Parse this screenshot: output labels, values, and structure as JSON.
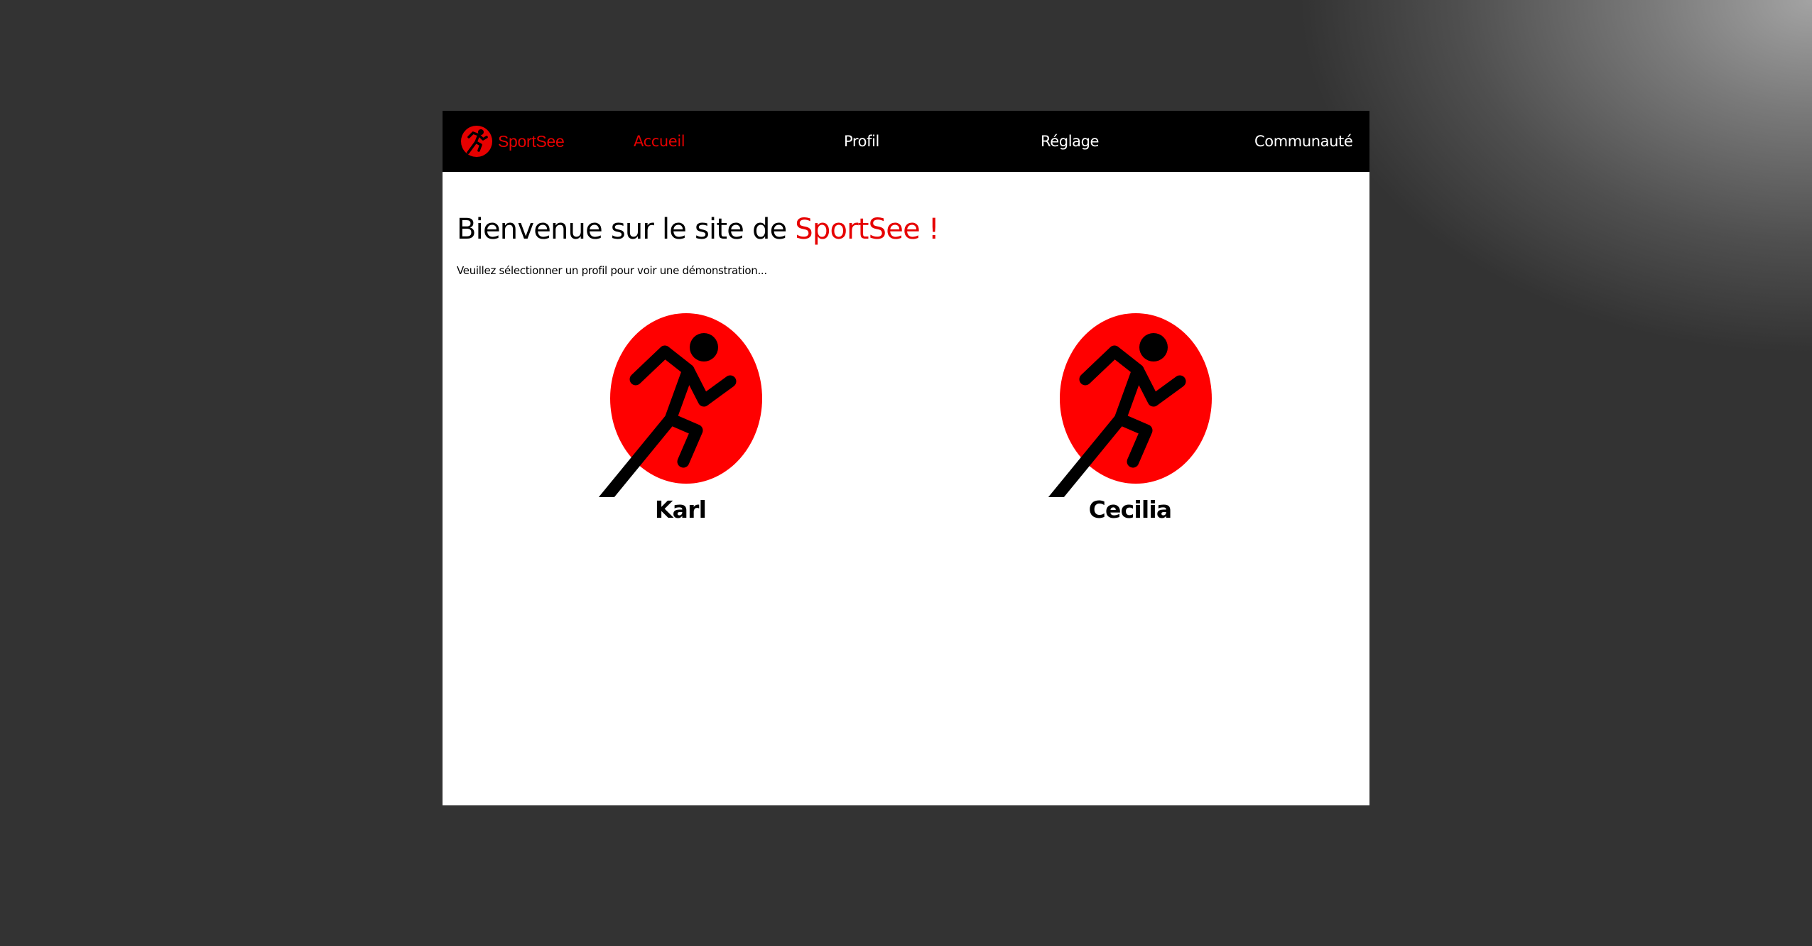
{
  "brand": {
    "name": "SportSee",
    "icon": "runner-icon",
    "accent_color": "#e60000"
  },
  "nav": {
    "items": [
      {
        "label": "Accueil",
        "active": true
      },
      {
        "label": "Profil",
        "active": false
      },
      {
        "label": "Réglage",
        "active": false
      },
      {
        "label": "Communauté",
        "active": false
      }
    ]
  },
  "main": {
    "title_prefix": "Bienvenue sur le site de",
    "title_brand": "SportSee !",
    "subtitle": "Veuillez sélectionner un profil pour voir une démonstration...",
    "profiles": [
      {
        "name": "Karl",
        "icon": "runner-icon"
      },
      {
        "name": "Cecilia",
        "icon": "runner-icon"
      }
    ]
  },
  "colors": {
    "topbar_bg": "#000000",
    "page_bg": "#ffffff",
    "backdrop": "#333333"
  }
}
